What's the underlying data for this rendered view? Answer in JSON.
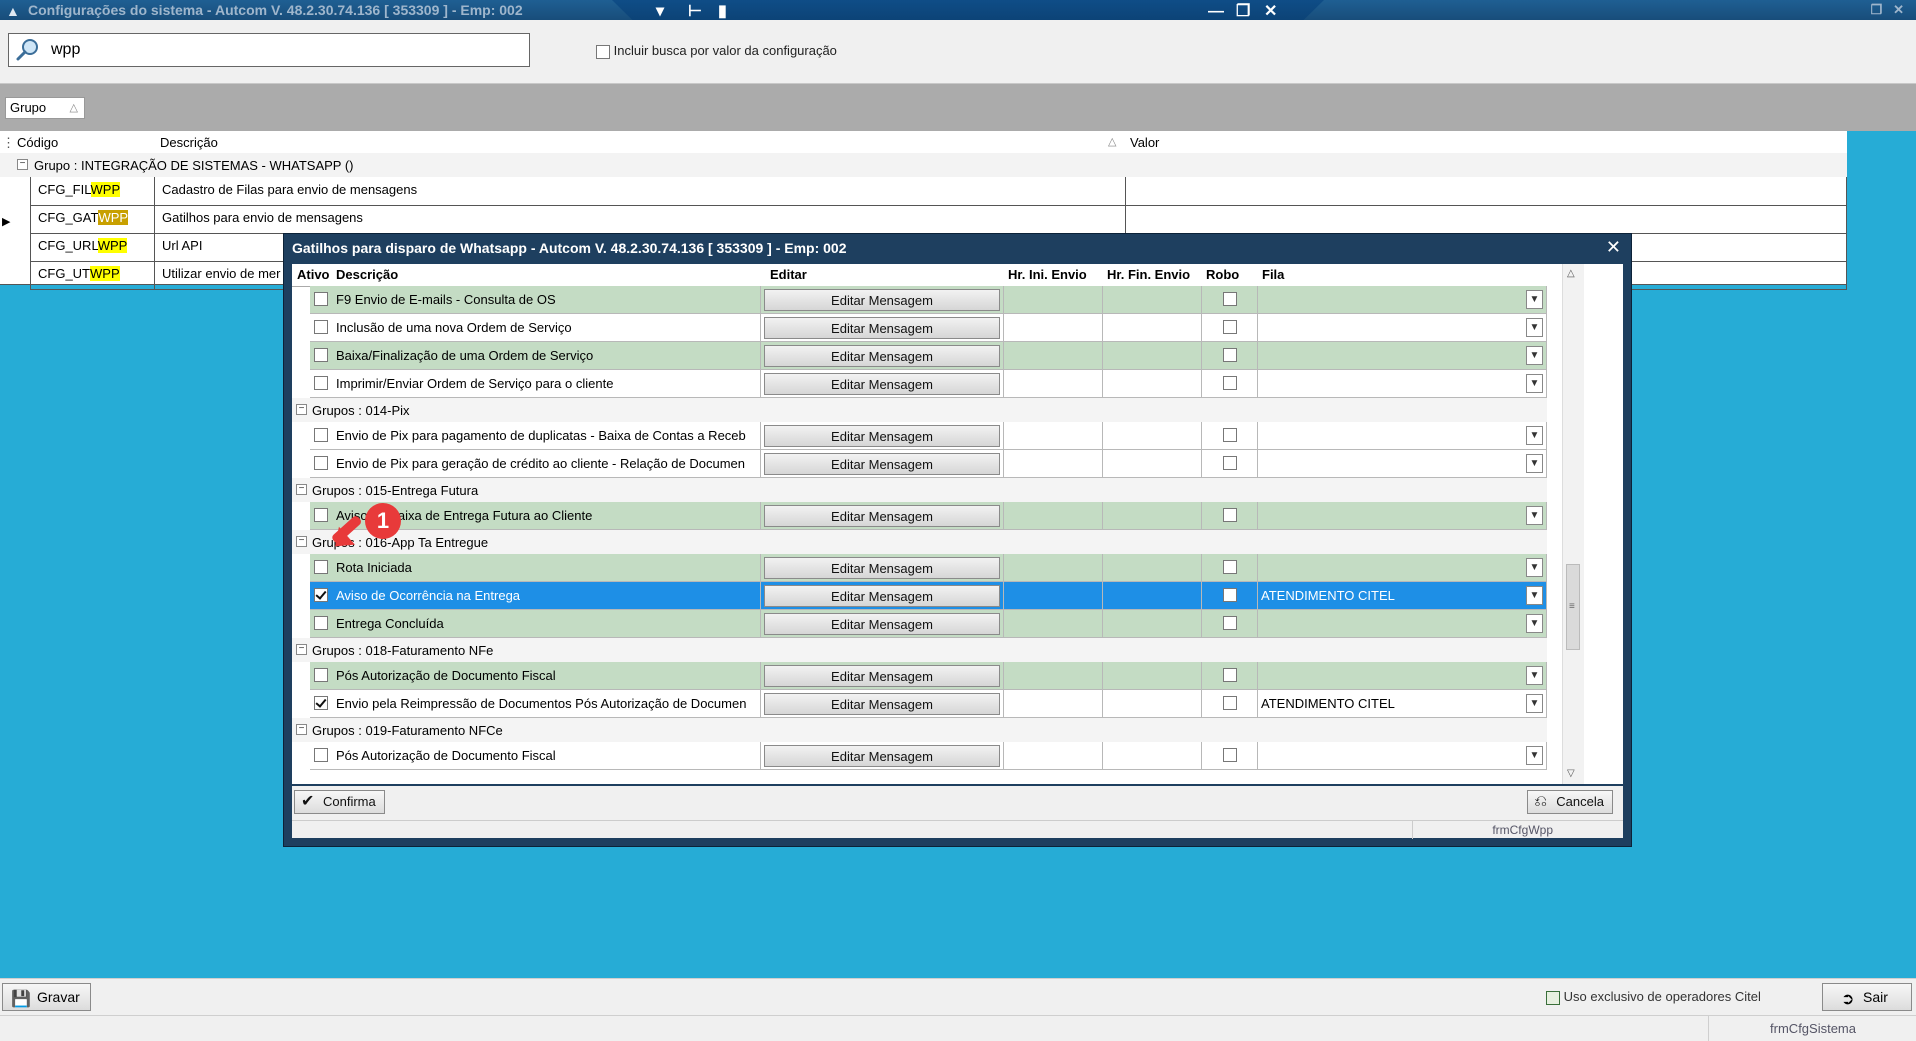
{
  "window": {
    "title": "Configurações do sistema  -  Autcom V. 48.2.30.74.136 [ 353309 ] - Emp: 002",
    "icon": "app-icon"
  },
  "toolbar_tab": {
    "icons": [
      "chevron-down-icon",
      "pin-icon",
      "signal-icon",
      "minimize-icon",
      "restore-icon",
      "close-icon"
    ]
  },
  "search": {
    "value": "wpp",
    "include_value_label": "Incluir busca por valor da configuração",
    "include_value_checked": false
  },
  "group_chip": {
    "label": "Grupo"
  },
  "grid": {
    "columns": [
      "Código",
      "Descrição",
      "Valor"
    ],
    "group_label": "Grupo : INTEGRAÇÃO DE SISTEMAS - WHATSAPP ()",
    "rows": [
      {
        "code_prefix": "CFG_FIL",
        "code_hl": "WPP",
        "desc": "Cadastro de Filas para envio de mensagens"
      },
      {
        "code_prefix": "CFG_GAT",
        "code_hl": "WPP",
        "desc": "Gatilhos para envio de mensagens"
      },
      {
        "code_prefix": "CFG_URL",
        "code_hl": "WPP",
        "desc": "Url API"
      },
      {
        "code_prefix": "CFG_UT",
        "code_hl": "WPP",
        "desc": "Utilizar envio de mer"
      }
    ]
  },
  "dialog": {
    "title": "Gatilhos para disparo de Whatsapp  -  Autcom V. 48.2.30.74.136 [ 353309 ] - Emp: 002",
    "columns": {
      "ativo": "Ativo",
      "descricao": "Descrição",
      "editar": "Editar",
      "hr_ini": "Hr. Ini. Envio",
      "hr_fin": "Hr. Fin. Envio",
      "robo": "Robo",
      "fila": "Fila"
    },
    "edit_button_label": "Editar Mensagem",
    "rows": [
      {
        "kind": "item",
        "style": "green",
        "ativo": false,
        "desc": "F9 Envio de E-mails - Consulta de OS",
        "robo": false,
        "fila": ""
      },
      {
        "kind": "item",
        "style": "white",
        "ativo": false,
        "desc": "Inclusão de uma nova Ordem de Serviço",
        "robo": false,
        "fila": ""
      },
      {
        "kind": "item",
        "style": "green",
        "ativo": false,
        "desc": "Baixa/Finalização de uma Ordem de Serviço",
        "robo": false,
        "fila": ""
      },
      {
        "kind": "item",
        "style": "white",
        "ativo": false,
        "desc": "Imprimir/Enviar Ordem de Serviço para o cliente",
        "robo": false,
        "fila": ""
      },
      {
        "kind": "group",
        "label": "Grupos : 014-Pix"
      },
      {
        "kind": "item",
        "style": "white",
        "ativo": false,
        "desc": "Envio de Pix para pagamento de duplicatas - Baixa de Contas a Receb",
        "robo": false,
        "fila": ""
      },
      {
        "kind": "item",
        "style": "white",
        "ativo": false,
        "desc": "Envio de Pix para geração de crédito ao cliente - Relação de Documen",
        "robo": false,
        "fila": ""
      },
      {
        "kind": "group",
        "label": "Grupos : 015-Entrega Futura"
      },
      {
        "kind": "item",
        "style": "green",
        "ativo": false,
        "desc": "Aviso de Baixa de Entrega Futura ao Cliente",
        "robo": false,
        "fila": ""
      },
      {
        "kind": "group",
        "label": "Grupos : 016-App Ta Entregue"
      },
      {
        "kind": "item",
        "style": "green",
        "ativo": false,
        "desc": "Rota Iniciada",
        "robo": false,
        "fila": ""
      },
      {
        "kind": "item",
        "style": "selected",
        "ativo": true,
        "desc": "Aviso de Ocorrência na Entrega",
        "robo": false,
        "fila": "ATENDIMENTO CITEL"
      },
      {
        "kind": "item",
        "style": "green",
        "ativo": false,
        "desc": "Entrega Concluída",
        "robo": false,
        "fila": ""
      },
      {
        "kind": "group",
        "label": "Grupos : 018-Faturamento NFe"
      },
      {
        "kind": "item",
        "style": "green",
        "ativo": false,
        "desc": "Pós Autorização de Documento Fiscal",
        "robo": false,
        "fila": ""
      },
      {
        "kind": "item",
        "style": "white",
        "ativo": true,
        "desc": "Envio pela Reimpressão de Documentos Pós Autorização de Documen",
        "robo": false,
        "fila": "ATENDIMENTO CITEL"
      },
      {
        "kind": "group",
        "label": "Grupos : 019-Faturamento NFCe"
      },
      {
        "kind": "item",
        "style": "white",
        "ativo": false,
        "desc": "Pós Autorização de Documento Fiscal",
        "robo": false,
        "fila": ""
      }
    ],
    "confirm_label": "Confirma",
    "cancel_label": "Cancela",
    "status_form": "frmCfgWpp"
  },
  "annotation": {
    "number": "1"
  },
  "bottom": {
    "save_label": "Gravar",
    "exclusive_label": "Uso exclusivo de operadores Citel",
    "exit_label": "Sair",
    "status_form": "frmCfgSistema"
  },
  "colors": {
    "desktop": "#26acd6",
    "row_green": "#c4dcc4",
    "row_selected": "#1e8fe6",
    "highlight": "#ffff00",
    "marker": "#e83a3a"
  }
}
